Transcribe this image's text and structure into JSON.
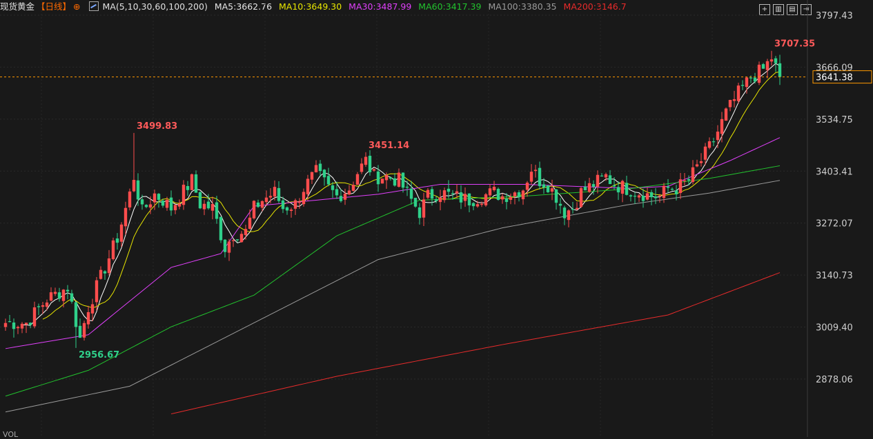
{
  "header": {
    "title": "现货黄金",
    "period": "【日线】",
    "period_arrow": "⊕",
    "ma_label": "MA(5,10,30,60,100,200)",
    "ma5": "MA5:3662.76",
    "ma10": "MA10:3649.30",
    "ma30": "MA30:3487.99",
    "ma60": "MA60:3417.39",
    "ma100": "MA100:3380.35",
    "ma200": "MA200:3146.7"
  },
  "toolbar": {
    "icons": [
      "crosshair-icon",
      "layout-icon",
      "indicator-icon",
      "exit-icon"
    ]
  },
  "colors": {
    "bg": "#191919",
    "up": "#ff4d4d",
    "down": "#2fd08a",
    "ma5": "#ffffff",
    "ma10": "#e8e600",
    "ma30": "#e040fb",
    "ma60": "#22c32e",
    "ma100": "#9b9b9b",
    "ma200": "#e82b2b",
    "price_line": "#ff9900"
  },
  "chart_data": {
    "type": "candlestick",
    "yticks": [
      3797.43,
      3666.09,
      3534.75,
      3403.41,
      3272.07,
      3140.73,
      3009.4,
      2878.06
    ],
    "ylim": [
      2790,
      3820
    ],
    "current_price": "3641.38",
    "annotations": [
      {
        "label": "3707.35",
        "value": 3707.35,
        "index": 185
      },
      {
        "label": "3499.83",
        "value": 3499.83,
        "index": 31
      },
      {
        "label": "3451.14",
        "value": 3451.14,
        "index": 87
      },
      {
        "label": "2956.67",
        "value": 2956.67,
        "index": 17
      }
    ],
    "series_meta": [
      {
        "name": "MA5",
        "period": 5,
        "color": "#ffffff"
      },
      {
        "name": "MA10",
        "period": 10,
        "color": "#e8e600"
      },
      {
        "name": "MA30",
        "period": 30,
        "color": "#e040fb"
      },
      {
        "name": "MA60",
        "period": 60,
        "color": "#22c32e"
      },
      {
        "name": "MA100",
        "period": 100,
        "color": "#9b9b9b"
      },
      {
        "name": "MA200",
        "period": 200,
        "color": "#e82b2b"
      }
    ],
    "ma_anchors": {
      "MA30": [
        [
          0,
          2955
        ],
        [
          20,
          2990
        ],
        [
          40,
          3160
        ],
        [
          52,
          3195
        ],
        [
          60,
          3315
        ],
        [
          75,
          3330
        ],
        [
          90,
          3345
        ],
        [
          105,
          3370
        ],
        [
          125,
          3370
        ],
        [
          150,
          3360
        ],
        [
          160,
          3365
        ],
        [
          175,
          3430
        ],
        [
          187,
          3488
        ]
      ],
      "MA60": [
        [
          0,
          2835
        ],
        [
          20,
          2900
        ],
        [
          40,
          3010
        ],
        [
          60,
          3090
        ],
        [
          80,
          3240
        ],
        [
          100,
          3330
        ],
        [
          125,
          3340
        ],
        [
          150,
          3358
        ],
        [
          170,
          3385
        ],
        [
          187,
          3417
        ]
      ],
      "MA100": [
        [
          0,
          2795
        ],
        [
          30,
          2860
        ],
        [
          60,
          3020
        ],
        [
          90,
          3180
        ],
        [
          120,
          3260
        ],
        [
          150,
          3318
        ],
        [
          170,
          3348
        ],
        [
          187,
          3380
        ]
      ],
      "MA200": [
        [
          40,
          2790
        ],
        [
          80,
          2885
        ],
        [
          120,
          2965
        ],
        [
          160,
          3040
        ],
        [
          187,
          3147
        ]
      ]
    },
    "close_path": [
      [
        0,
        3020
      ],
      [
        5,
        3020
      ],
      [
        10,
        3080
      ],
      [
        15,
        3110
      ],
      [
        18,
        2980
      ],
      [
        20,
        3060
      ],
      [
        24,
        3160
      ],
      [
        27,
        3235
      ],
      [
        30,
        3345
      ],
      [
        31,
        3390
      ],
      [
        33,
        3300
      ],
      [
        36,
        3345
      ],
      [
        38,
        3330
      ],
      [
        40,
        3310
      ],
      [
        45,
        3380
      ],
      [
        47,
        3320
      ],
      [
        50,
        3310
      ],
      [
        53,
        3210
      ],
      [
        55,
        3245
      ],
      [
        58,
        3250
      ],
      [
        60,
        3310
      ],
      [
        62,
        3330
      ],
      [
        65,
        3350
      ],
      [
        67,
        3310
      ],
      [
        70,
        3320
      ],
      [
        72,
        3360
      ],
      [
        75,
        3400
      ],
      [
        78,
        3360
      ],
      [
        80,
        3340
      ],
      [
        83,
        3360
      ],
      [
        85,
        3400
      ],
      [
        87,
        3430
      ],
      [
        89,
        3390
      ],
      [
        92,
        3390
      ],
      [
        95,
        3380
      ],
      [
        98,
        3330
      ],
      [
        100,
        3300
      ],
      [
        102,
        3340
      ],
      [
        105,
        3350
      ],
      [
        108,
        3340
      ],
      [
        112,
        3330
      ],
      [
        115,
        3340
      ],
      [
        118,
        3350
      ],
      [
        120,
        3340
      ],
      [
        123,
        3350
      ],
      [
        125,
        3360
      ],
      [
        127,
        3410
      ],
      [
        129,
        3380
      ],
      [
        131,
        3370
      ],
      [
        133,
        3340
      ],
      [
        135,
        3300
      ],
      [
        137,
        3310
      ],
      [
        139,
        3350
      ],
      [
        142,
        3370
      ],
      [
        145,
        3390
      ],
      [
        147,
        3370
      ],
      [
        150,
        3360
      ],
      [
        153,
        3350
      ],
      [
        156,
        3340
      ],
      [
        158,
        3340
      ],
      [
        160,
        3360
      ],
      [
        162,
        3360
      ],
      [
        165,
        3380
      ],
      [
        168,
        3430
      ],
      [
        171,
        3480
      ],
      [
        174,
        3550
      ],
      [
        177,
        3600
      ],
      [
        180,
        3640
      ],
      [
        183,
        3660
      ],
      [
        185,
        3690
      ],
      [
        187,
        3642
      ]
    ]
  }
}
